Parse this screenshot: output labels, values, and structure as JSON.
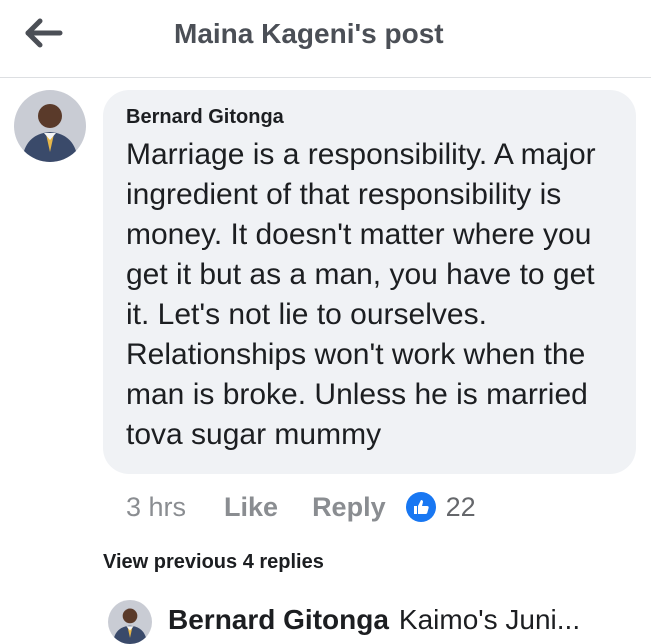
{
  "header": {
    "title": "Maina Kageni's post",
    "back_icon": "arrow-left-icon"
  },
  "comment": {
    "author": "Bernard Gitonga",
    "text": "Marriage is a responsibility. A major\ningredient of that responsibility is\nmoney. It doesn't matter where you\nget it but as a man, you have to get\nit. Let's not lie to ourselves.\nRelationships won't work when the\nman is broke. Unless he is married\ntova sugar mummy",
    "time": "3 hrs",
    "like_label": "Like",
    "reply_label": "Reply",
    "reaction_icon": "thumbs-up-icon",
    "reaction_count": "22"
  },
  "view_previous": "View previous 4 replies",
  "reply": {
    "author": "Bernard Gitonga",
    "text": "Kaimo's Juni..."
  },
  "colors": {
    "bubble": "#f0f2f5",
    "like_blue": "#1877f2",
    "muted": "#8a8d91"
  }
}
